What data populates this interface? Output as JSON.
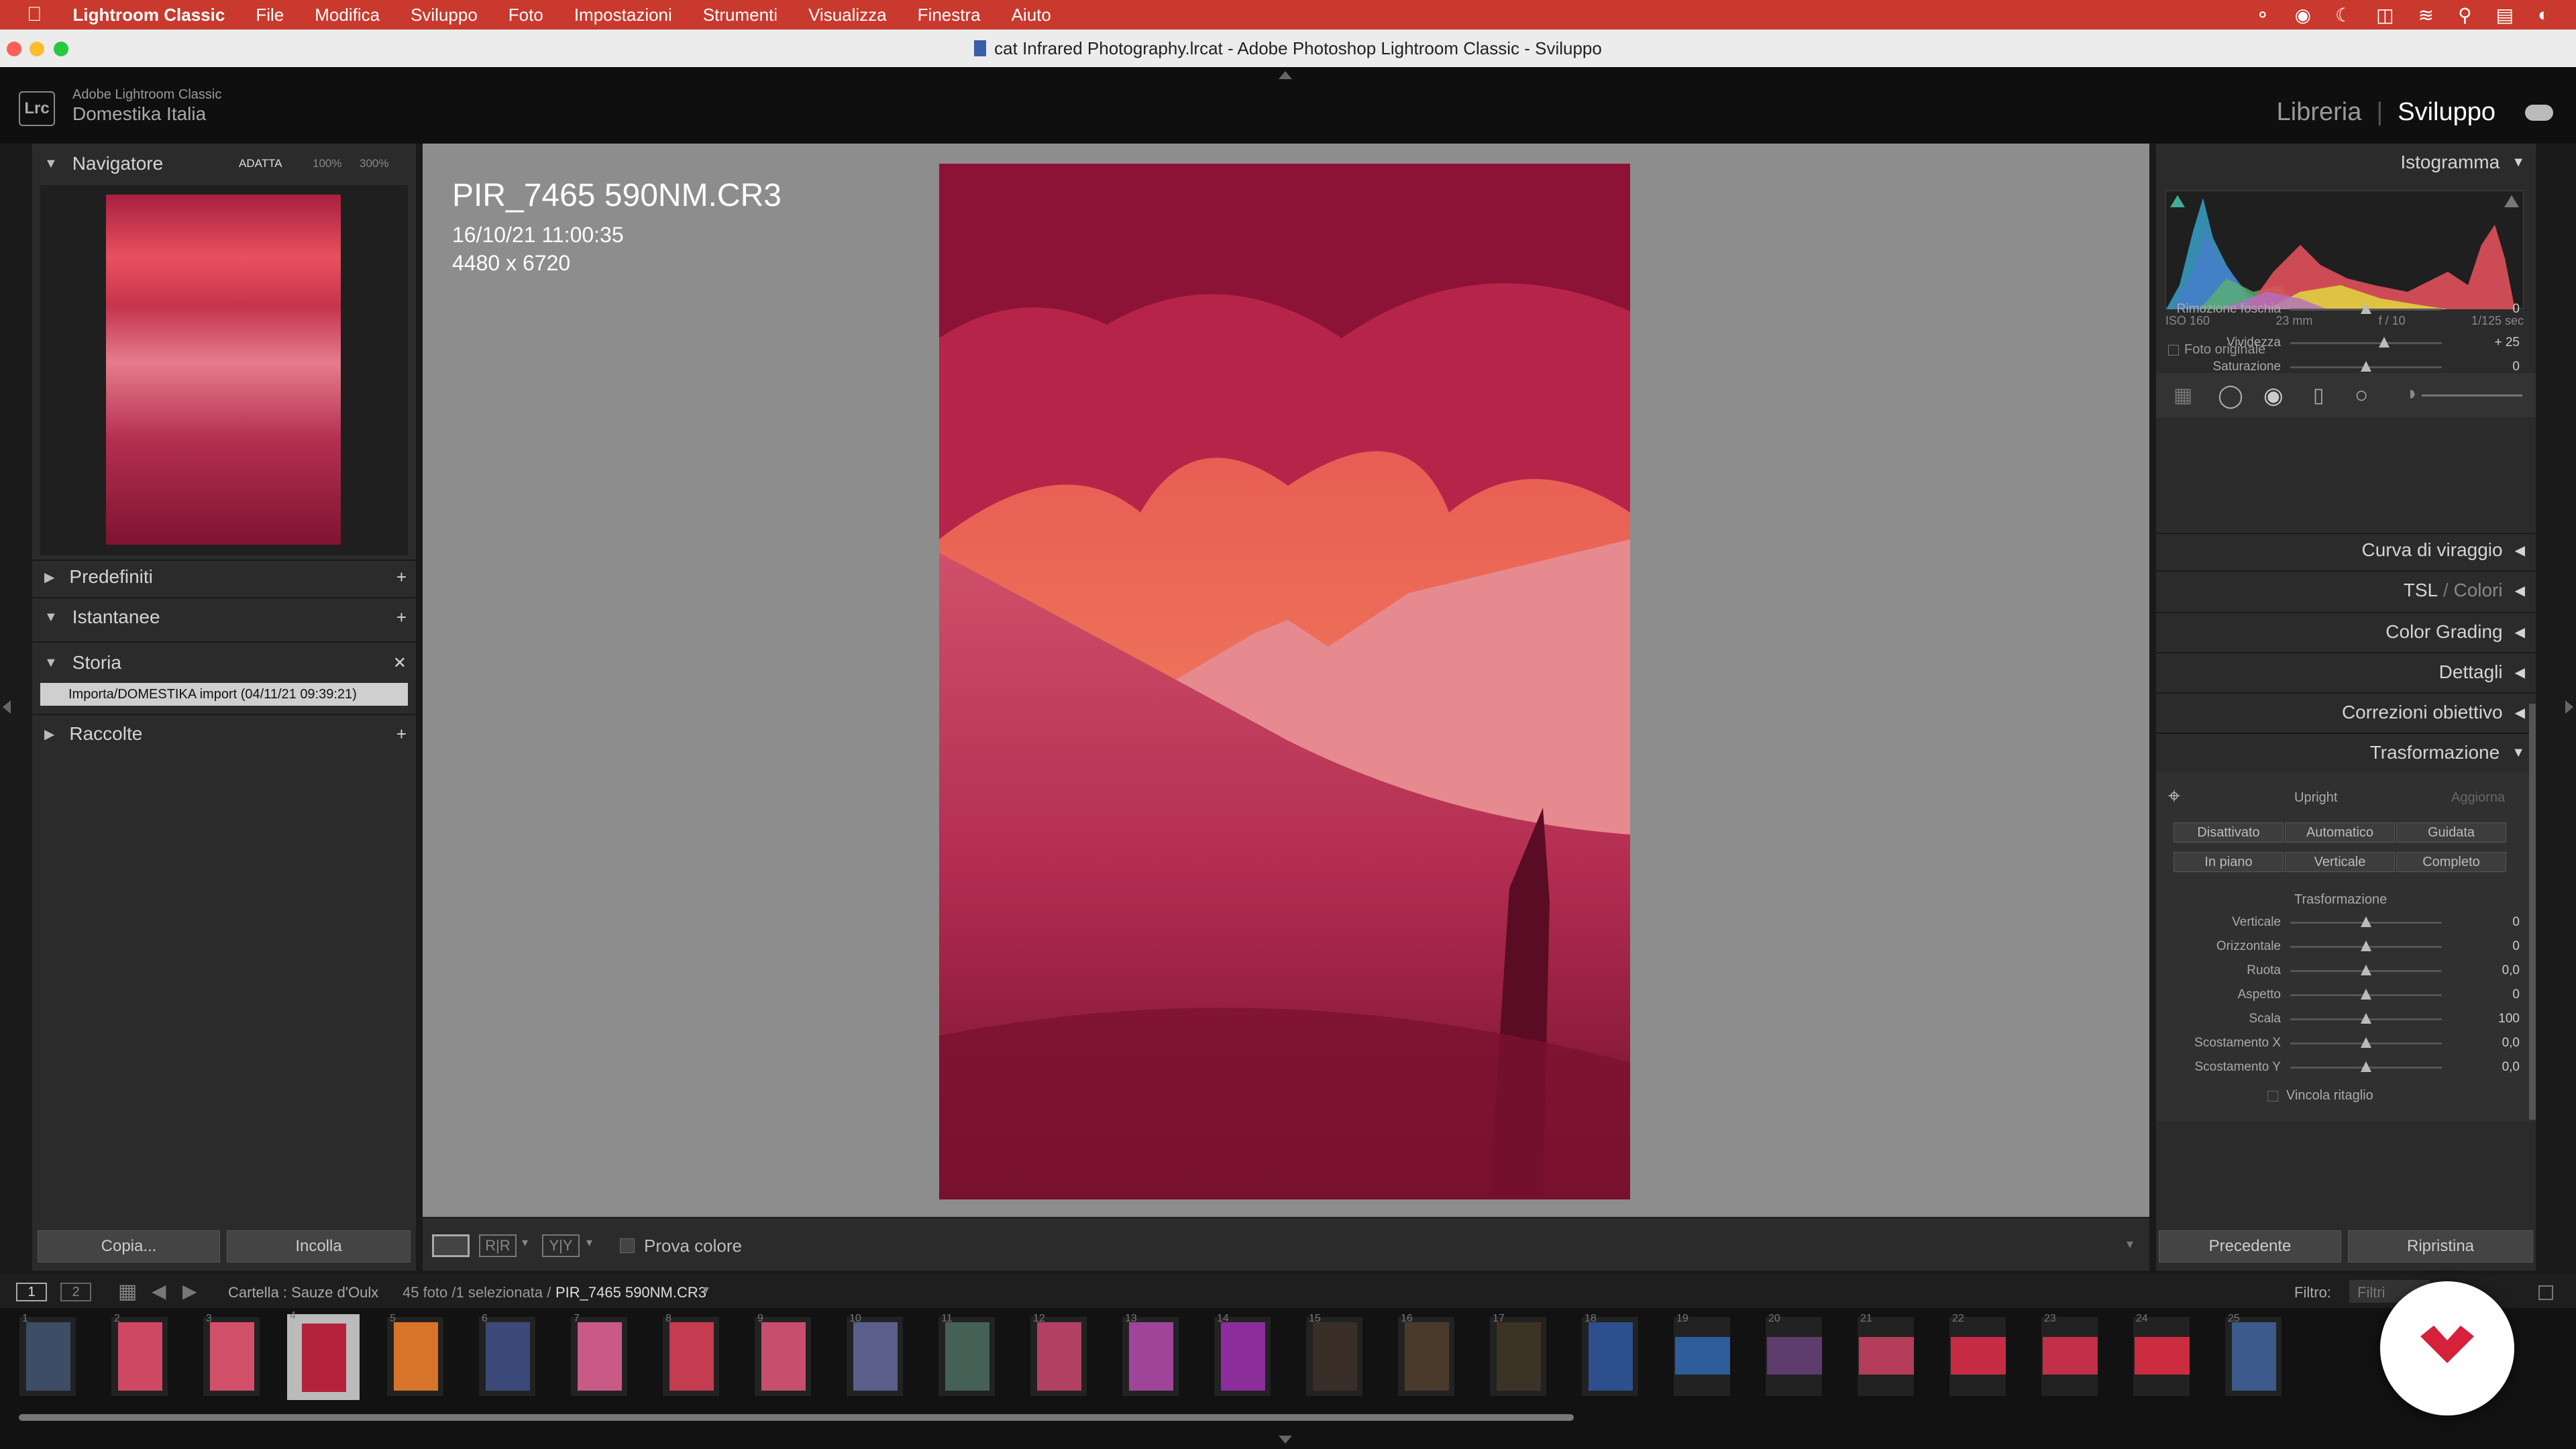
{
  "menubar": {
    "app": "Lightroom Classic",
    "items": [
      "File",
      "Modifica",
      "Sviluppo",
      "Foto",
      "Impostazioni",
      "Strumenti",
      "Visualizza",
      "Finestra",
      "Aiuto"
    ]
  },
  "window": {
    "title": "cat Infrared Photography.lrcat - Adobe Photoshop Lightroom Classic - Sviluppo"
  },
  "identity": {
    "badge": "Lrc",
    "line1": "Adobe Lightroom Classic",
    "line2": "Domestika Italia"
  },
  "modules": {
    "libreria": "Libreria",
    "separator": "|",
    "sviluppo": "Sviluppo"
  },
  "navigator": {
    "title": "Navigatore",
    "zoom": [
      "ADATTA",
      "100%",
      "300%"
    ]
  },
  "left_panels": {
    "predefiniti": "Predefiniti",
    "istantanee": "Istantanee",
    "storia": "Storia",
    "storia_item": "Importa/DOMESTIKA import (04/11/21 09:39:21)",
    "raccolte": "Raccolte"
  },
  "left_buttons": {
    "copia": "Copia...",
    "incolla": "Incolla"
  },
  "photo": {
    "filename": "PIR_7465 590NM.CR3",
    "datetime": "16/10/21 11:00:35",
    "dimensions": "4480 x 6720"
  },
  "toolbar": {
    "prova_colore": "Prova colore"
  },
  "histogram": {
    "title": "Istogramma",
    "iso": "ISO 160",
    "focal": "23 mm",
    "aperture": "f / 10",
    "shutter": "1/125 sec",
    "original": "Foto originale"
  },
  "presence": {
    "rows": [
      {
        "label": "Rimozione foschia",
        "value": "0",
        "pos": 0.5
      },
      {
        "label": "Vividezza",
        "value": "+ 25",
        "pos": 0.62
      },
      {
        "label": "Saturazione",
        "value": "0",
        "pos": 0.5
      }
    ]
  },
  "sections": {
    "curve": "Curva di viraggio",
    "tsl": "TSL",
    "tsl_sep": " / ",
    "colori": "Colori",
    "color_grading": "Color Grading",
    "dettagli": "Dettagli",
    "correzioni": "Correzioni obiettivo",
    "trasformazione": "Trasformazione"
  },
  "upright": {
    "label": "Upright",
    "update": "Aggiorna",
    "buttons": [
      "Disattivato",
      "Automatico",
      "Guidata",
      "In piano",
      "Verticale",
      "Completo"
    ],
    "subtitle": "Trasformazione"
  },
  "transform_rows": [
    {
      "label": "Verticale",
      "value": "0",
      "pos": 0.5
    },
    {
      "label": "Orizzontale",
      "value": "0",
      "pos": 0.5
    },
    {
      "label": "Ruota",
      "value": "0,0",
      "pos": 0.5
    },
    {
      "label": "Aspetto",
      "value": "0",
      "pos": 0.5
    },
    {
      "label": "Scala",
      "value": "100",
      "pos": 0.5
    },
    {
      "label": "Scostamento X",
      "value": "0,0",
      "pos": 0.5
    },
    {
      "label": "Scostamento Y",
      "value": "0,0",
      "pos": 0.5
    }
  ],
  "vincola": "Vincola ritaglio",
  "right_buttons": {
    "precedente": "Precedente",
    "ripristina": "Ripristina"
  },
  "filmstrip_bar": {
    "screen1": "1",
    "screen2": "2",
    "folder": "Cartella : Sauze d'Oulx",
    "count": "45 foto /1 selezionata /",
    "selected": "PIR_7465 590NM.CR3",
    "filter_label": "Filtro:",
    "filter_value": "Filtri"
  },
  "filmstrip": {
    "selected_index": 3,
    "numbers": [
      "1",
      "2",
      "3",
      "4",
      "5",
      "6",
      "7",
      "8",
      "9",
      "10",
      "11",
      "12",
      "13",
      "14",
      "15",
      "16",
      "17",
      "18",
      "19",
      "20",
      "21",
      "22",
      "23",
      "24",
      "25"
    ]
  },
  "colors": {
    "menubar": "#c9392d",
    "accent_red": "#d5223a",
    "photo_pink": "#c23358"
  }
}
